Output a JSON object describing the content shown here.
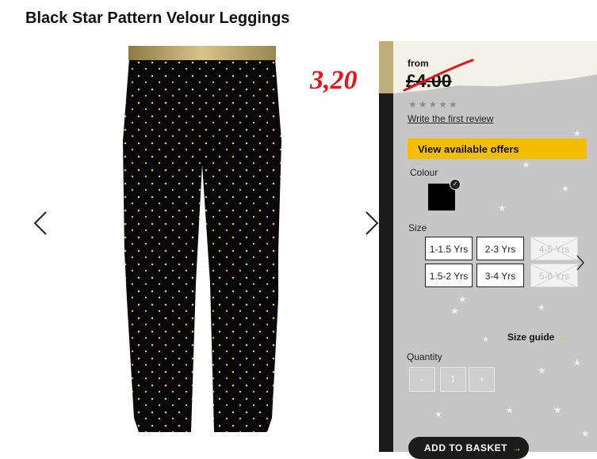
{
  "product": {
    "title": "Black Star Pattern Velour Leggings"
  },
  "price": {
    "from_label": "from",
    "old_price": "£4.00",
    "handwritten_price": "3,20",
    "handwritten_color": "#e8121b"
  },
  "rating": {
    "stars": "★★★★★",
    "review_link": "Write the first review"
  },
  "offers": {
    "label": "View available offers",
    "color": "#f5be00"
  },
  "colour": {
    "label": "Colour",
    "selected": "#000000"
  },
  "size": {
    "label": "Size",
    "options": [
      {
        "label": "1-1.5 Yrs",
        "available": true
      },
      {
        "label": "2-3 Yrs",
        "available": true
      },
      {
        "label": "4-5 Yrs",
        "available": false
      },
      {
        "label": "1.5-2 Yrs",
        "available": true
      },
      {
        "label": "3-4 Yrs",
        "available": true
      },
      {
        "label": "5-6 Yrs",
        "available": false
      }
    ],
    "guide_label": "Size guide",
    "guide_arrow": "→"
  },
  "quantity": {
    "label": "Quantity",
    "minus": "-",
    "value": "1",
    "plus": "+"
  },
  "basket": {
    "label": "ADD TO BASKET",
    "arrow": "→"
  }
}
